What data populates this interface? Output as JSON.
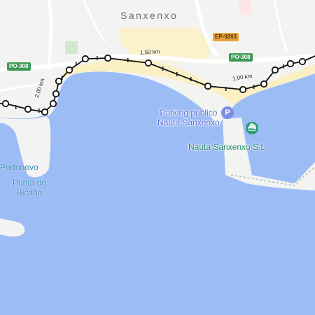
{
  "map": {
    "town_label": "Sanxenxo",
    "roads": {
      "po308_left": "PO-308",
      "po308_right": "PO-308",
      "ep9203": "EP-9203"
    },
    "distance_markers": {
      "d150": "1,50 km",
      "d100": "1,00 km",
      "d200": "2,00 km"
    },
    "pois": {
      "parking_line1": "Parking público",
      "parking_line2": "Nauta Sanxenxo",
      "nauta": "Nauta Sanxenxo S.L"
    },
    "places": {
      "portonovo": "Portonovo",
      "punta_line1": "Punta do",
      "punta_line2": "Bicaño"
    },
    "icons": {
      "parking": "parking-pin-icon",
      "boat": "boat-pin-icon"
    },
    "colors": {
      "water": "#9cbcf5",
      "land": "#f3f3f2",
      "beach": "#fbf0c4",
      "road_green": "#3f9a57",
      "road_orange": "#e9a33d",
      "route": "#111111"
    }
  }
}
